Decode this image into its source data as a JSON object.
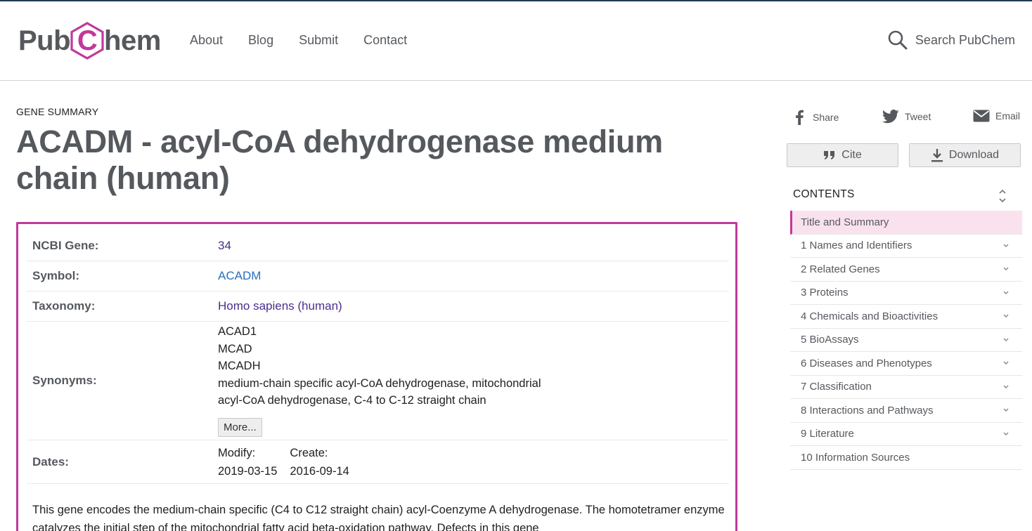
{
  "header": {
    "logo_left": "Pub",
    "logo_c": "C",
    "logo_right": "hem",
    "nav": [
      "About",
      "Blog",
      "Submit",
      "Contact"
    ],
    "search_label": "Search PubChem"
  },
  "page": {
    "kicker": "GENE SUMMARY",
    "title": "ACADM - acyl-CoA dehydrogenase medium chain (human)"
  },
  "summary": {
    "ncbi_label": "NCBI Gene:",
    "ncbi_value": "34",
    "symbol_label": "Symbol:",
    "symbol_value": "ACADM",
    "taxonomy_label": "Taxonomy:",
    "taxonomy_value": "Homo sapiens (human)",
    "synonyms_label": "Synonyms:",
    "synonyms": [
      "ACAD1",
      "MCAD",
      "MCADH",
      "medium-chain specific acyl-CoA dehydrogenase, mitochondrial",
      "acyl-CoA dehydrogenase, C-4 to C-12 straight chain"
    ],
    "more_label": "More...",
    "dates_label": "Dates:",
    "modify_label": "Modify:",
    "modify_value": "2019-03-15",
    "create_label": "Create:",
    "create_value": "2016-09-14",
    "description": "This gene encodes the medium-chain specific (C4 to C12 straight chain) acyl-Coenzyme A dehydrogenase. The homotetramer enzyme catalyzes the initial step of the mitochondrial fatty acid beta-oxidation pathway. Defects in this gene"
  },
  "sidebar": {
    "share": "Share",
    "tweet": "Tweet",
    "email": "Email",
    "cite": "Cite",
    "download": "Download",
    "contents_title": "CONTENTS",
    "toc": [
      "Title and Summary",
      "1 Names and Identifiers",
      "2 Related Genes",
      "3 Proteins",
      "4 Chemicals and Bioactivities",
      "5 BioAssays",
      "6 Diseases and Phenotypes",
      "7 Classification",
      "8 Interactions and Pathways",
      "9 Literature",
      "10 Information Sources"
    ]
  },
  "colors": {
    "brand_magenta": "#c0399b",
    "text_gray": "#55595e",
    "link_purple": "#4a2e8c",
    "link_blue": "#2b6eb8",
    "toc_active_bg": "#f9e2ee"
  }
}
